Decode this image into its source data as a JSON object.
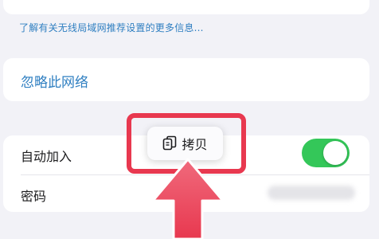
{
  "info_link": "了解有关无线局域网推荐设置的更多信息...",
  "forget_network_label": "忽略此网络",
  "settings": {
    "auto_join_label": "自动加入",
    "auto_join_enabled": true,
    "password_label": "密码"
  },
  "context_menu": {
    "copy_label": "拷贝",
    "copy_icon": "copy-icon"
  },
  "colors": {
    "link": "#2f7fc1",
    "toggle_on": "#34c759",
    "annotation": "#e8384f"
  }
}
